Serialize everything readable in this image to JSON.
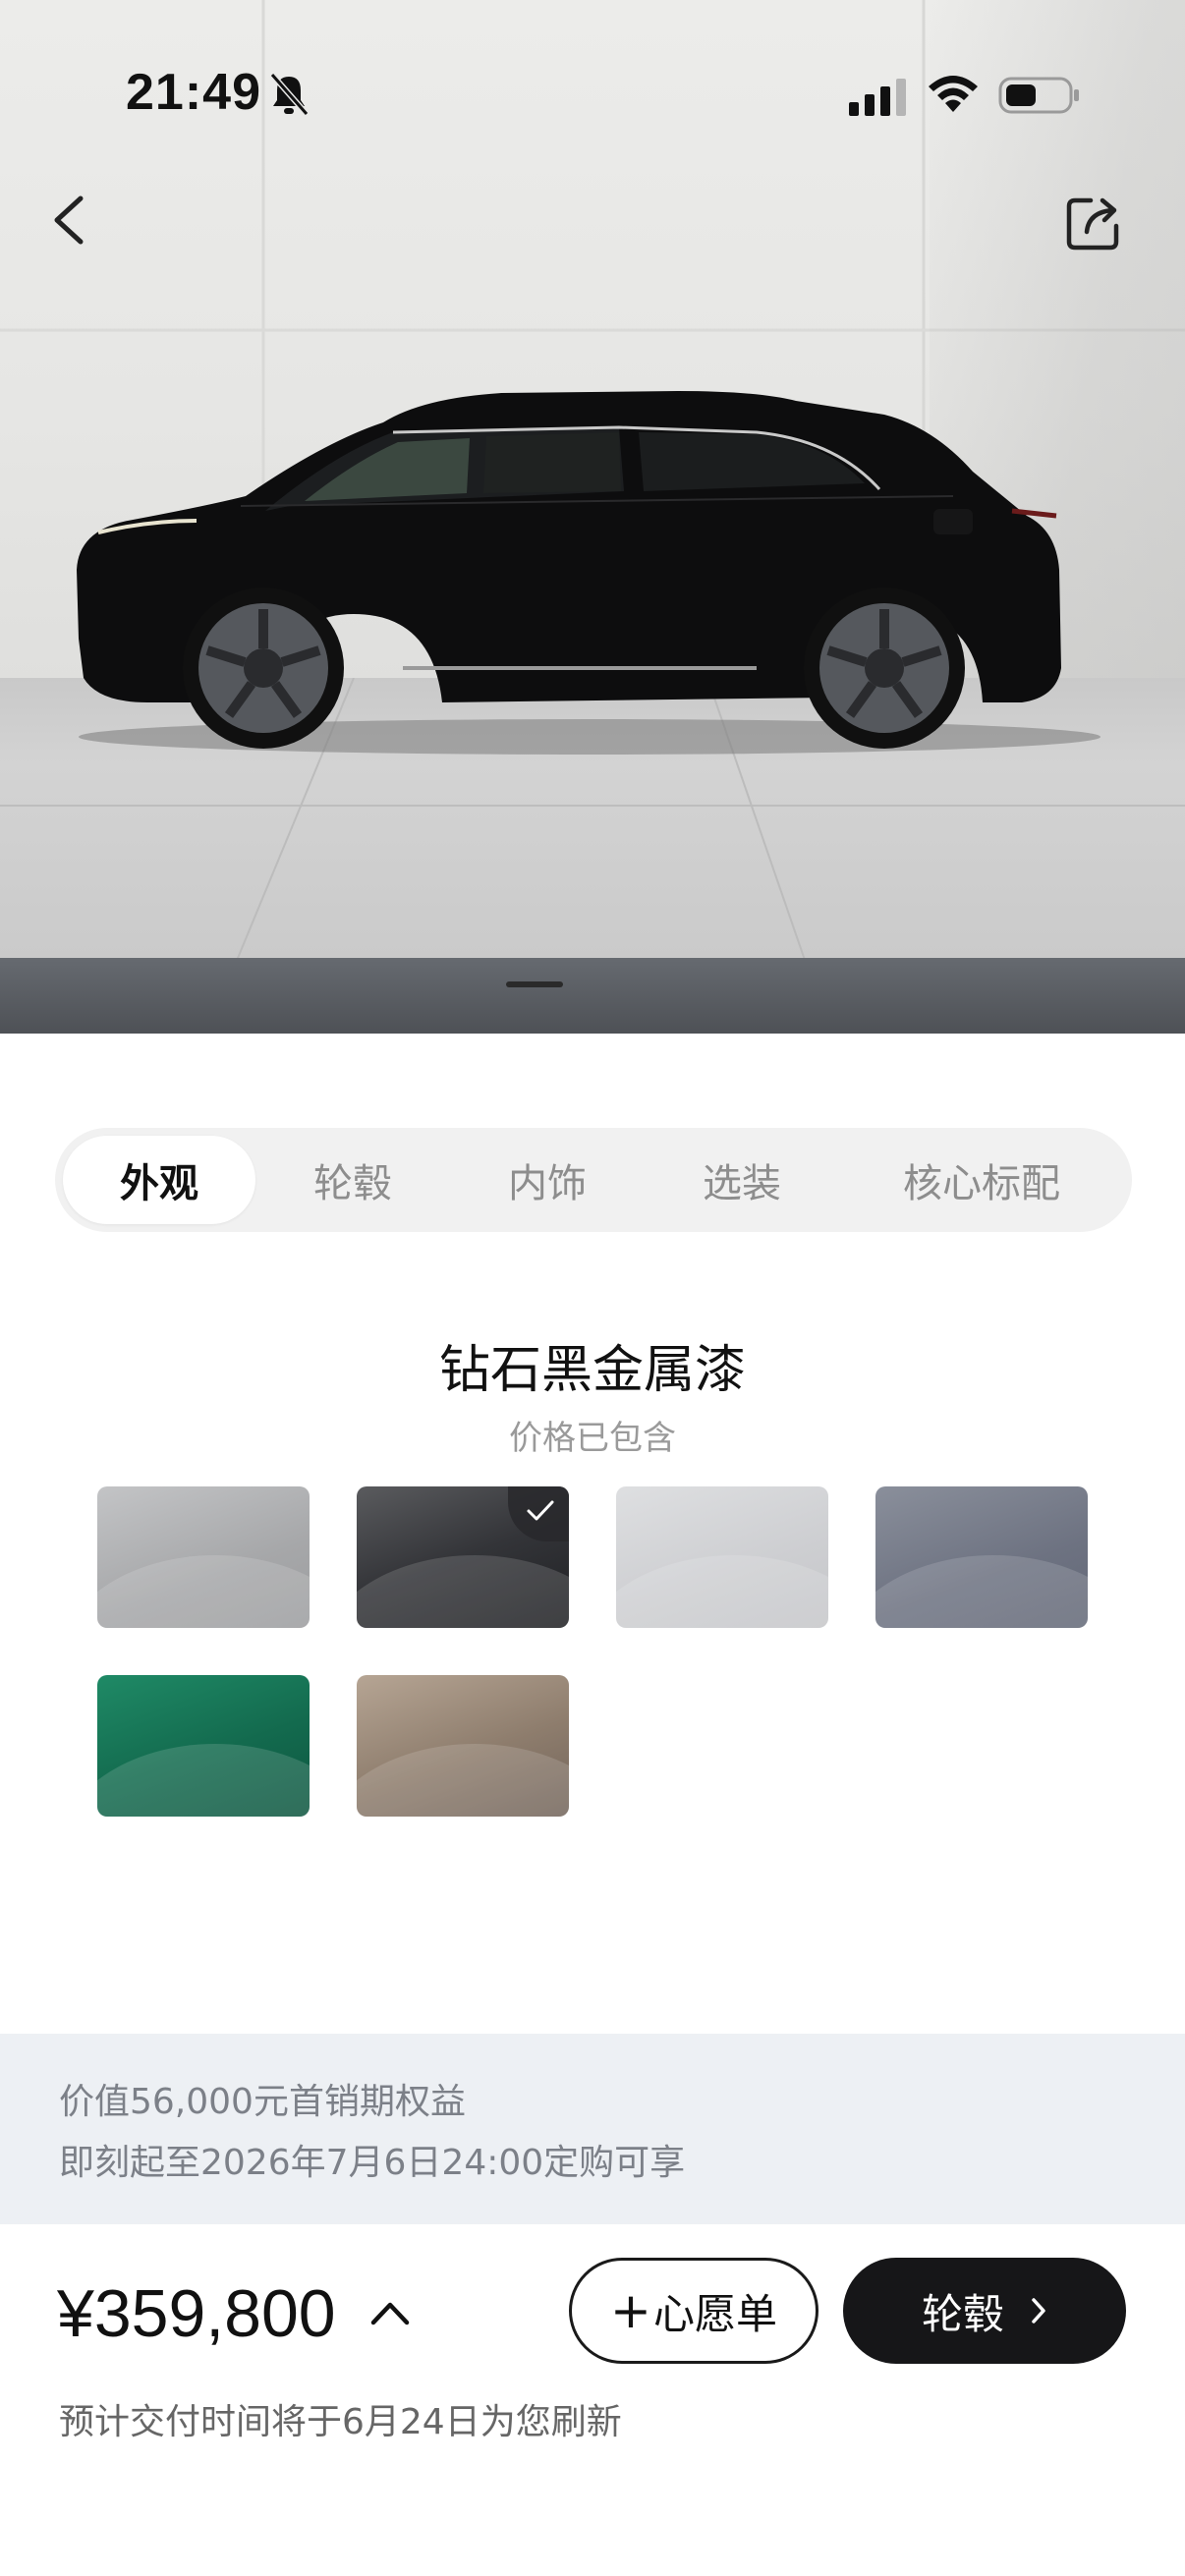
{
  "status_bar": {
    "time": "21:49"
  },
  "tabs": [
    {
      "label": "外观",
      "active": true
    },
    {
      "label": "轮毂",
      "active": false
    },
    {
      "label": "内饰",
      "active": false
    },
    {
      "label": "选装",
      "active": false
    },
    {
      "label": "核心标配",
      "active": false
    }
  ],
  "color": {
    "selected_name": "钻石黑金属漆",
    "price_note": "价格已包含",
    "swatches": [
      {
        "color": "#a8a9ab",
        "selected": false
      },
      {
        "color": "#2c2d31",
        "selected": true
      },
      {
        "color": "#cfd0d3",
        "selected": false
      },
      {
        "color": "#6f7483",
        "selected": false
      },
      {
        "color": "#136a4e",
        "selected": false
      },
      {
        "color": "#8e7d6d",
        "selected": false
      }
    ]
  },
  "promo": {
    "line1": "价值56,000元首销期权益",
    "line2": "即刻起至2026年7月6日24:00定购可享"
  },
  "bottom": {
    "price": "¥359,800",
    "wishlist_label": "心愿单",
    "wishlist_prefix": "+",
    "next_label": "轮毂",
    "delivery_note": "预计交付时间将于6月24日为您刷新"
  },
  "icons": {
    "back": "chevron-left-icon",
    "share": "share-icon",
    "bell_muted": "bell-slash-icon",
    "signal": "cellular-signal-icon",
    "wifi": "wifi-icon",
    "battery": "battery-icon",
    "price_caret": "chevron-up-icon",
    "next_arrow": "chevron-right-icon",
    "check": "checkmark-icon"
  },
  "colors": {
    "primary_button": "#161618",
    "promo_background": "#edf0f4",
    "tab_background": "#f1f1f1"
  }
}
